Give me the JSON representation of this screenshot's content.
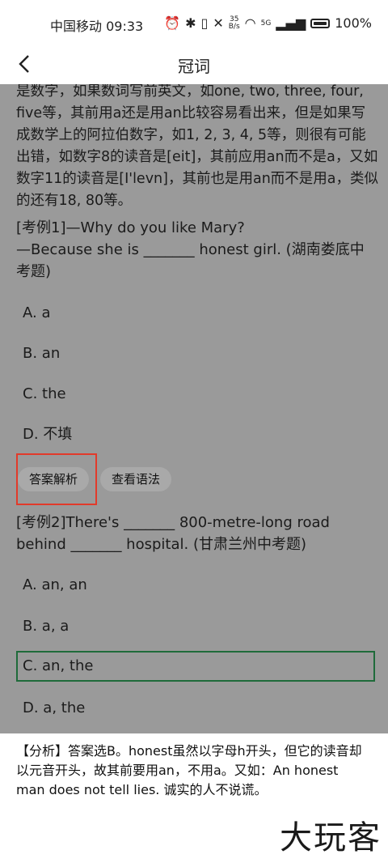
{
  "status": {
    "carrier_time": "中国移动 09:33",
    "speed_top": "35",
    "speed_bottom": "B/s",
    "signal": "5G",
    "battery": "100%"
  },
  "header": {
    "title": "冠词"
  },
  "intro_text": "是数字，如果数词写前英文，如one, two, three, four, five等，其前用a还是用an比较容易看出来，但是如果写成数学上的阿拉伯数字，如1, 2, 3, 4, 5等，则很有可能出错，如数字8的读音是[eit]，其前应用an而不是a，又如数字11的读音是[I'levn]，其前也是用an而不是用a，类似的还有18, 80等。",
  "example1": {
    "question": "[考例1]—Why do you like Mary?\n—Because she is _______ honest girl. (湖南娄底中考题)",
    "options": [
      "A. a",
      "B. an",
      "C. the",
      "D. 不填"
    ],
    "buttons": {
      "analysis": "答案解析",
      "grammar": "查看语法"
    }
  },
  "example2": {
    "question": "[考例2]There's _______ 800-metre-long road behind _______ hospital. (甘肃兰州中考题)",
    "options": [
      "A. an, an",
      "B. a, a",
      "C. an, the",
      "D. a, the"
    ],
    "selected_index": 2
  },
  "analysis": {
    "text": "【分析】答案选B。honest虽然以字母h开头，但它的读音却以元音开头，故其前要用an，不用a。又如：An honest man does not tell lies. 诚实的人不说谎。"
  },
  "watermark": "大玩客",
  "colors": {
    "overlay": "#9a9a9a",
    "selected_border": "#1f6b3a",
    "highlight": "#e23a2a"
  }
}
